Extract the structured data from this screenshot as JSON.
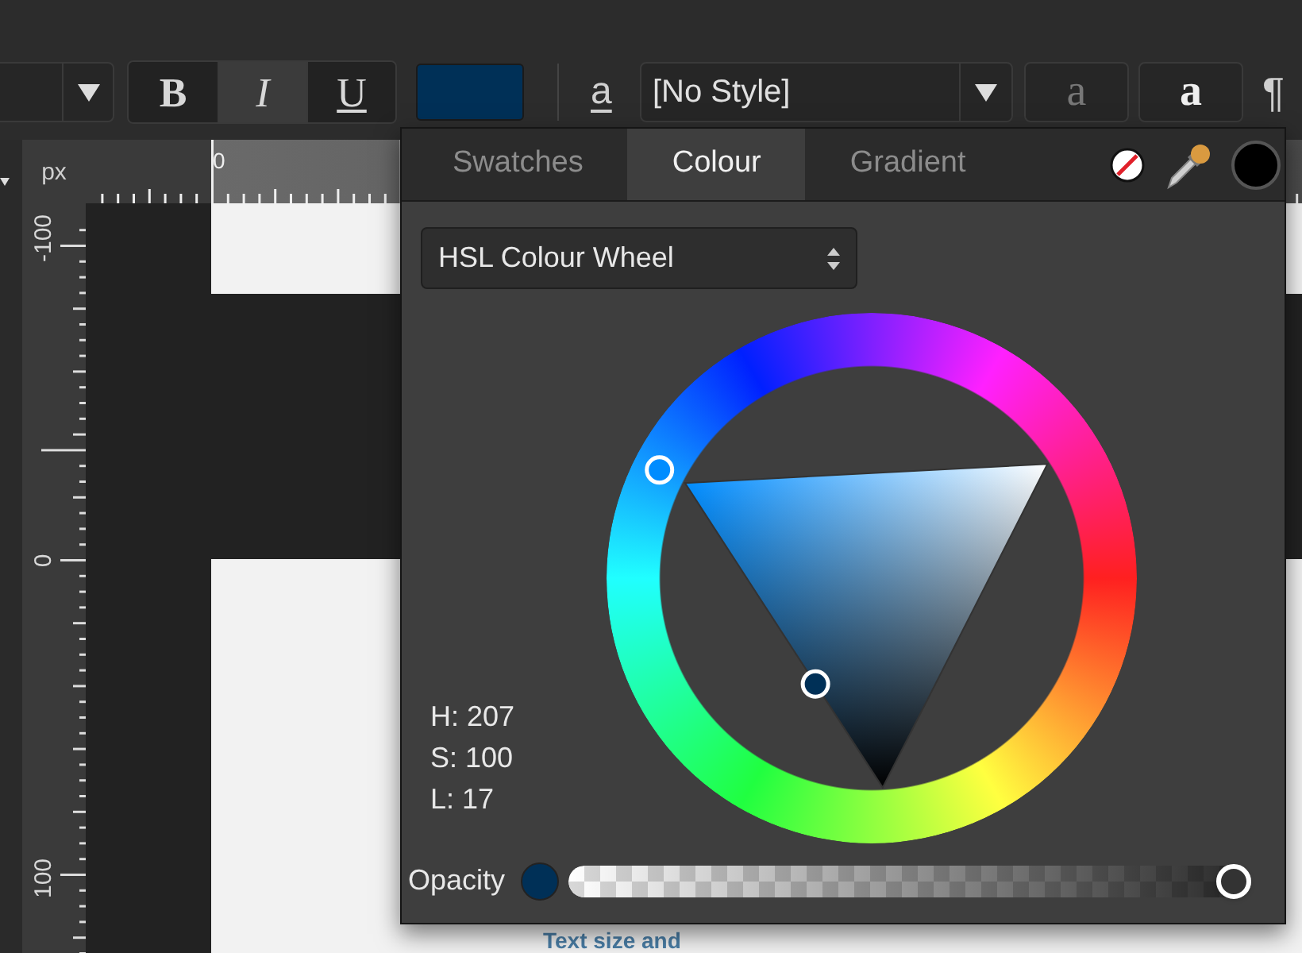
{
  "toolbar": {
    "format_buttons": [
      {
        "label": "B",
        "kind": "bold",
        "selected": false
      },
      {
        "label": "I",
        "kind": "italic",
        "selected": true
      },
      {
        "label": "U",
        "kind": "underline",
        "selected": false
      }
    ],
    "text_style_icon": "a",
    "style_dropdown": {
      "value": "[No Style]"
    },
    "character_buttons": [
      {
        "label": "a",
        "kind": "outlined"
      },
      {
        "label": "a",
        "kind": "plain"
      }
    ],
    "paragraph_mark": "¶"
  },
  "rulers": {
    "unit": "px",
    "horizontal_labels": [
      "0"
    ],
    "vertical_labels": [
      "-100",
      "0",
      "100"
    ]
  },
  "canvas": {
    "text": "Text size and"
  },
  "colour_panel": {
    "tabs": [
      {
        "label": "Swatches",
        "selected": false
      },
      {
        "label": "Colour",
        "selected": true
      },
      {
        "label": "Gradient",
        "selected": false
      }
    ],
    "mode_dropdown": {
      "value": "HSL Colour Wheel"
    },
    "readouts": [
      "H: 207",
      "S: 100",
      "L: 17"
    ],
    "opacity": {
      "label": "Opacity",
      "level": 1
    }
  }
}
